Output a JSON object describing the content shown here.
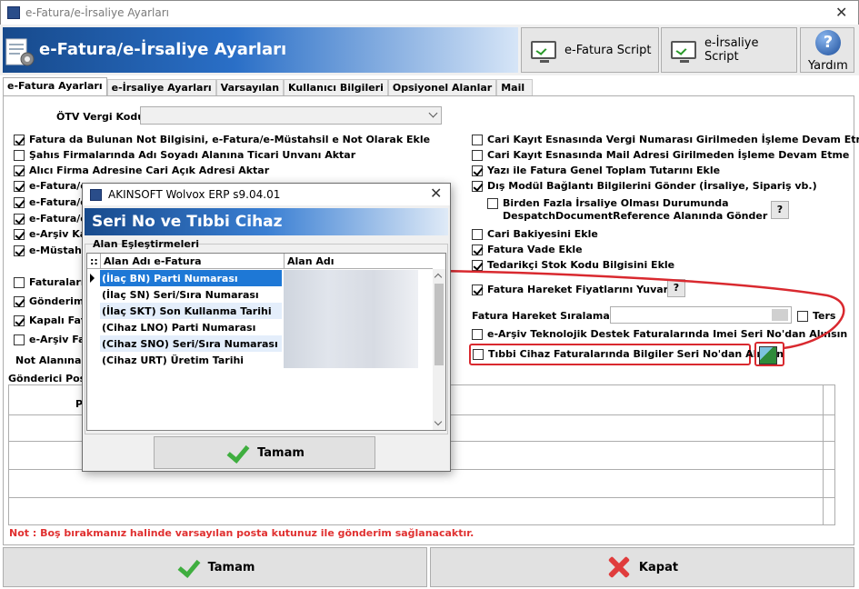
{
  "window": {
    "title": "e-Fatura/e-İrsaliye Ayarları"
  },
  "header": {
    "title": "e-Fatura/e-İrsaliye Ayarları",
    "efatura_script": "e-Fatura Script",
    "eirsaliye_script": "e-İrsaliye Script",
    "help": "Yardım",
    "help_glyph": "?"
  },
  "tabs": [
    "e-Fatura Ayarları",
    "e-İrsaliye Ayarları",
    "Varsayılan",
    "Kullanıcı Bilgileri",
    "Opsiyonel Alanlar",
    "Mail"
  ],
  "otv": {
    "label": "ÖTV Vergi Kodu",
    "value": ""
  },
  "left_checks": [
    {
      "label": "Fatura da Bulunan Not Bilgisini, e-Fatura/e-Müstahsil e Not Olarak Ekle",
      "checked": true
    },
    {
      "label": "Şahıs Firmalarında Adı Soyadı Alanına Ticari Unvanı Aktar",
      "checked": false
    },
    {
      "label": "Alıcı Firma Adresine Cari Açık Adresi Aktar",
      "checked": true
    },
    {
      "label": "e-Fatura/e",
      "checked": true
    },
    {
      "label": "e-Fatura/e",
      "checked": true
    },
    {
      "label": "e-Fatura/e",
      "checked": true
    },
    {
      "label": "e-Arşiv Ka",
      "checked": true
    },
    {
      "label": "e-Müstahs",
      "checked": true
    },
    {
      "label": "Faturaları T",
      "checked": false
    },
    {
      "label": "Gönderim F",
      "checked": true
    },
    {
      "label": "Kapalı Fatu",
      "checked": true
    },
    {
      "label": "e-Arşiv Fat",
      "checked": false
    }
  ],
  "right_checks": [
    {
      "label": "Cari Kayıt Esnasında Vergi Numarası Girilmeden İşleme Devam Etme",
      "checked": false
    },
    {
      "label": "Cari Kayıt Esnasında Mail Adresi Girilmeden İşleme Devam Etme",
      "checked": false
    },
    {
      "label": "Yazı ile Fatura Genel Toplam Tutarını Ekle",
      "checked": true
    },
    {
      "label": "Dış Modül Bağlantı Bilgilerini Gönder (İrsaliye, Sipariş vb.)",
      "checked": true
    },
    {
      "label": "Birden Fazla İrsaliye Olması Durumunda",
      "checked": false
    },
    {
      "label": "Cari Bakiyesini Ekle",
      "checked": false
    },
    {
      "label": "Fatura Vade Ekle",
      "checked": true
    },
    {
      "label": "Tedarikçi Stok Kodu Bilgisini Ekle",
      "checked": true
    },
    {
      "label": "Fatura Hareket Fiyatlarını Yuvarla",
      "checked": true
    },
    {
      "label": "e-Arşiv Teknolojik Destek Faturalarında Imei Seri No'dan Alınsın",
      "checked": false
    },
    {
      "label": "Tıbbi Cihaz Faturalarında Bilgiler Seri No'dan Alınsın",
      "checked": false
    }
  ],
  "despatch_line2": "DespatchDocumentReference Alanında Gönder",
  "q_glyph": "?",
  "siralama": {
    "label": "Fatura Hareket Sıralaması",
    "ters": "Ters"
  },
  "not_alani": "Not Alanına E",
  "gonderici": "Gönderici Pos",
  "grid_p": "P",
  "note": "Not : Boş bırakmanız halinde varsayılan posta kutunuz ile gönderim sağlanacaktır.",
  "bottom": {
    "ok": "Tamam",
    "close": "Kapat"
  },
  "dialog": {
    "title": "AKINSOFT Wolvox ERP s9.04.01",
    "banner": "Seri No ve Tıbbi Cihaz",
    "group": "Alan Eşleştirmeleri",
    "col1": "Alan Adı e-Fatura",
    "col2": "Alan Adı",
    "col_marker": "::",
    "rows": [
      "(İlaç BN) Parti Numarası",
      "(İlaç SN) Seri/Sıra  Numarası",
      "(İlaç SKT) Son Kullanma Tarihi",
      "(Cihaz LNO) Parti Numarası",
      "(Cihaz SNO) Seri/Sıra Numarası",
      "(Cihaz URT) Üretim Tarihi"
    ],
    "ok": "Tamam"
  }
}
